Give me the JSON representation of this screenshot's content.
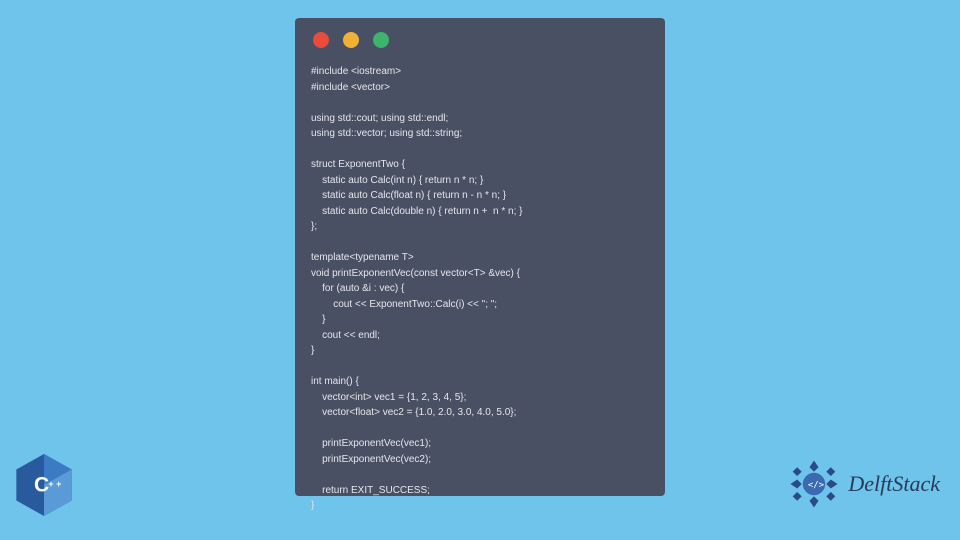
{
  "window": {
    "traffic_light_colors": {
      "red": "#e94b3c",
      "yellow": "#f2b134",
      "green": "#3db46d"
    }
  },
  "code": "#include <iostream>\n#include <vector>\n\nusing std::cout; using std::endl;\nusing std::vector; using std::string;\n\nstruct ExponentTwo {\n    static auto Calc(int n) { return n * n; }\n    static auto Calc(float n) { return n - n * n; }\n    static auto Calc(double n) { return n +  n * n; }\n};\n\ntemplate<typename T>\nvoid printExponentVec(const vector<T> &vec) {\n    for (auto &i : vec) {\n        cout << ExponentTwo::Calc(i) << \"; \";\n    }\n    cout << endl;\n}\n\nint main() {\n    vector<int> vec1 = {1, 2, 3, 4, 5};\n    vector<float> vec2 = {1.0, 2.0, 3.0, 4.0, 5.0};\n\n    printExponentVec(vec1);\n    printExponentVec(vec2);\n\n    return EXIT_SUCCESS;\n}",
  "badges": {
    "cpp_label": "C++",
    "delftstack_label": "DelftStack"
  }
}
